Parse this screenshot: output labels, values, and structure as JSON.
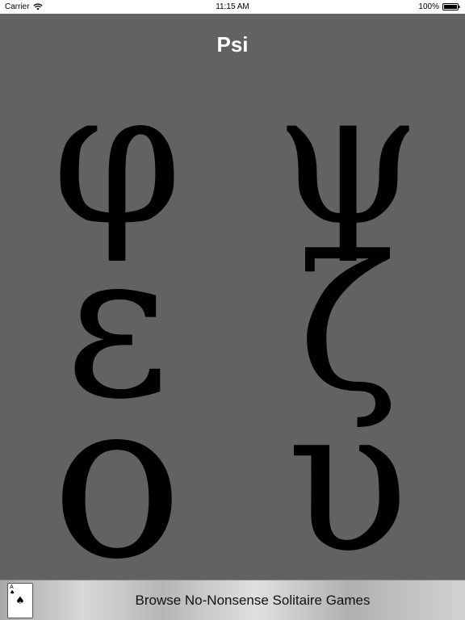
{
  "status_bar": {
    "carrier": "Carrier",
    "wifi_icon": "wifi-icon",
    "time": "11:15 AM",
    "battery_percent": "100%",
    "battery_icon": "battery-icon"
  },
  "title": "Psi",
  "letters": [
    {
      "name": "phi",
      "glyph": "φ"
    },
    {
      "name": "psi",
      "glyph": "ψ"
    },
    {
      "name": "epsilon",
      "glyph": "ε"
    },
    {
      "name": "zeta",
      "glyph": "ζ"
    },
    {
      "name": "omicron",
      "glyph": "ο"
    },
    {
      "name": "upsilon",
      "glyph": "υ"
    }
  ],
  "banner": {
    "card_rank": "A",
    "card_suit": "♠",
    "text": "Browse No-Nonsense Solitaire Games"
  },
  "colors": {
    "background": "#626262",
    "title": "#ffffff",
    "letters": "#000000"
  }
}
